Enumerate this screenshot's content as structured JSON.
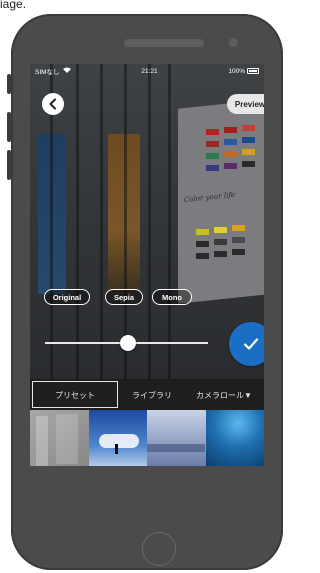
{
  "page_caption": "iage.",
  "status_bar": {
    "carrier": "SIMなし",
    "time": "21:21",
    "battery": "100%"
  },
  "header": {
    "back_icon": "chevron-left-icon",
    "preview_label": "Preview"
  },
  "filters": {
    "items": [
      {
        "label": "Original"
      },
      {
        "label": "Sepia"
      },
      {
        "label": "Mono"
      }
    ]
  },
  "slider": {
    "value": 0.52
  },
  "confirm": {
    "icon": "checkmark-icon",
    "color": "#1a6fc4"
  },
  "tabs": {
    "items": [
      {
        "label": "プリセット",
        "active": true
      },
      {
        "label": "ライブラリ",
        "active": false
      },
      {
        "label": "カメラロール▼",
        "active": false
      }
    ]
  },
  "thumbnails": [
    {
      "name": "thumb-gray-building",
      "colors": [
        "#9a9a9a",
        "#8a8a8a"
      ]
    },
    {
      "name": "thumb-sky-person",
      "colors": [
        "#1d4fa8",
        "#8cb8e8"
      ]
    },
    {
      "name": "thumb-misty-lake",
      "colors": [
        "#6a7ea8",
        "#b9c6de"
      ]
    },
    {
      "name": "thumb-underwater",
      "colors": [
        "#0a3b6a",
        "#2a8ac8"
      ]
    },
    {
      "name": "thumb-purple-sky",
      "colors": [
        "#2a1e6e",
        "#6a56c0"
      ]
    },
    {
      "name": "thumb-night-purple",
      "colors": [
        "#1a1a3a",
        "#4a3a8a"
      ]
    },
    {
      "name": "thumb-flowers",
      "colors": [
        "#b89ac8",
        "#e8d8f0"
      ]
    },
    {
      "name": "thumb-pink-glass",
      "colors": [
        "#7a1a5a",
        "#d84aa8"
      ]
    }
  ],
  "background_photo": {
    "poster_text": "Color your life"
  }
}
